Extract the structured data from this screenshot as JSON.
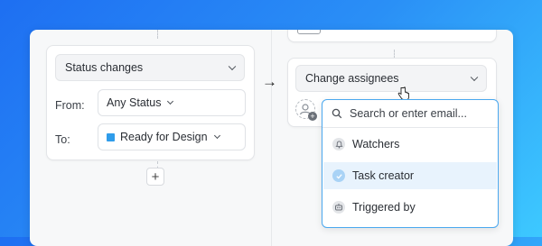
{
  "trigger": {
    "type_label": "Status changes",
    "from_label": "From:",
    "from_value": "Any Status",
    "to_label": "To:",
    "to_value": "Ready for Design"
  },
  "action": {
    "type_label": "Change assignees"
  },
  "dropdown": {
    "search_placeholder": "Search or enter email...",
    "items": [
      {
        "label": "Watchers",
        "icon": "bell-icon",
        "selected": false
      },
      {
        "label": "Task creator",
        "icon": "check-icon",
        "selected": true
      },
      {
        "label": "Triggered by",
        "icon": "robot-icon",
        "selected": false
      }
    ]
  },
  "colors": {
    "accent": "#2f9cea",
    "selected_bg": "#e8f3fd",
    "focus_border": "#4aa8ef"
  }
}
